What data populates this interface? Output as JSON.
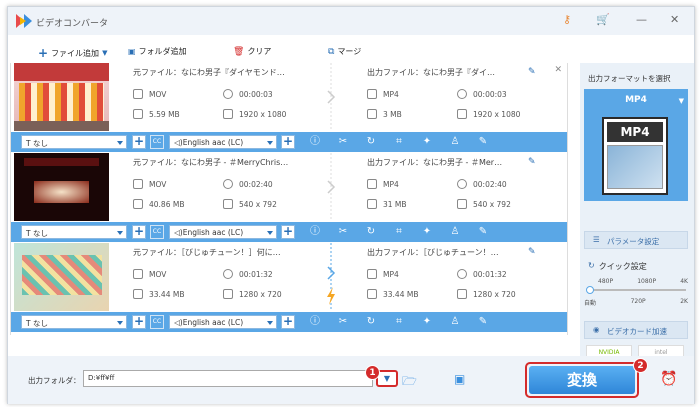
{
  "app": {
    "title": "ビデオコンバータ"
  },
  "toolbar": {
    "add_file": "ファイル追加",
    "add_folder": "フォルダ追加",
    "clear": "クリア",
    "merge": "マージ"
  },
  "files": [
    {
      "src_name": "元ファイル：なにわ男子『ダイヤモンド…",
      "src_format": "MOV",
      "src_duration": "00:00:03",
      "src_size": "5.59 MB",
      "src_res": "1920 x 1080",
      "out_name": "出力ファイル：なにわ男子『ダイ…",
      "out_format": "MP4",
      "out_duration": "00:00:03",
      "out_size": "3 MB",
      "out_res": "1920 x 1080",
      "subtitle": "なし",
      "audio": "English aac (LC)"
    },
    {
      "src_name": "元ファイル：なにわ男子 - ＃MerryChris…",
      "src_format": "MOV",
      "src_duration": "00:02:40",
      "src_size": "40.86 MB",
      "src_res": "540 x 792",
      "out_name": "出力ファイル：なにわ男子 - ＃Mer…",
      "out_format": "MP4",
      "out_duration": "00:02:40",
      "out_size": "31 MB",
      "out_res": "540 x 792",
      "subtitle": "なし",
      "audio": "English aac (LC)"
    },
    {
      "src_name": "元ファイル：［びじゅチューン！］何に…",
      "src_format": "MOV",
      "src_duration": "00:01:32",
      "src_size": "33.44 MB",
      "src_res": "1280 x 720",
      "out_name": "出力ファイル：［びじゅチューン！…",
      "out_format": "MP4",
      "out_duration": "00:01:32",
      "out_size": "33.44 MB",
      "out_res": "1280 x 720",
      "subtitle": "なし",
      "audio": "English aac (LC)"
    }
  ],
  "right": {
    "select_format": "出力フォーマットを選択",
    "format": "MP4",
    "thumb_label": "MP4",
    "param": "パラメータ設定",
    "quick": "クイック設定",
    "q_labels": [
      "480P",
      "1080P",
      "4K"
    ],
    "q_labels2": [
      "自動",
      "720P",
      "2K"
    ],
    "accel": "ビデオカード加速",
    "nvidia": "NVIDIA",
    "intel": "intel"
  },
  "bottom": {
    "out_label": "出力フォルダ：",
    "out_path": "D:¥ff¥ff",
    "convert": "変換"
  },
  "badges": [
    "1",
    "2"
  ],
  "colors": {
    "accent": "#5aa7e6",
    "convert": "#3a8fde",
    "badge": "#d42b2b"
  }
}
